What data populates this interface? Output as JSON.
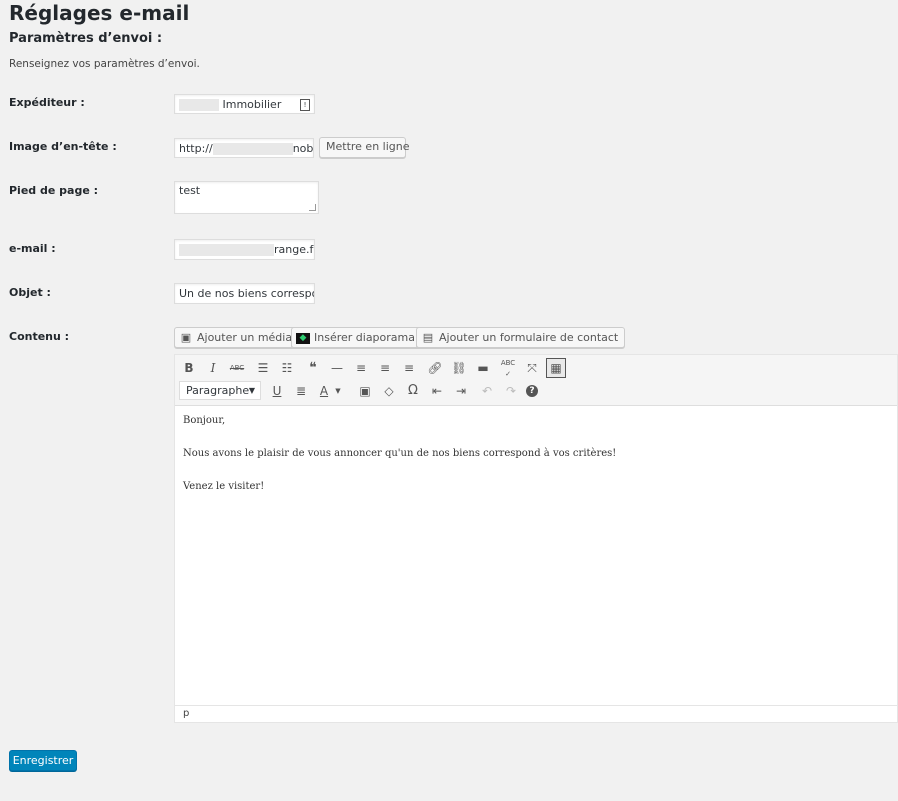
{
  "page": {
    "title": "Réglages e-mail",
    "section_title": "Paramètres d’envoi :",
    "description": "Renseignez vos paramètres d’envoi."
  },
  "form": {
    "sender": {
      "label": "Expéditeur :",
      "value": "Immobilier"
    },
    "header_image": {
      "label": "Image d’en-tête :",
      "value_start": "http://",
      "value_end": "nob",
      "upload_label": "Mettre en ligne"
    },
    "footer": {
      "label": "Pied de page :",
      "value": "test"
    },
    "email": {
      "label": "e-mail :",
      "value_end": "range.fr"
    },
    "subject": {
      "label": "Objet :",
      "value": "Un de nos biens correspon"
    },
    "content": {
      "label": "Contenu :"
    }
  },
  "media_buttons": {
    "add_media": "Ajouter un média",
    "insert_slideshow": "Insérer diaporama",
    "add_contact_form": "Ajouter un formulaire de contact"
  },
  "editor": {
    "format_select": "Paragraphe",
    "paragraphs": [
      "Bonjour,",
      "Nous avons le plaisir de vous annoncer qu'un de nos biens correspond à vos critères!",
      "Venez le visiter!"
    ],
    "status_path": "p",
    "icons": {
      "bold": "B",
      "italic": "I",
      "strike": "ABC",
      "quote": "❝",
      "text_color": "A",
      "omega": "Ω",
      "spell": "ABC",
      "help": "?"
    }
  },
  "actions": {
    "save": "Enregistrer"
  }
}
